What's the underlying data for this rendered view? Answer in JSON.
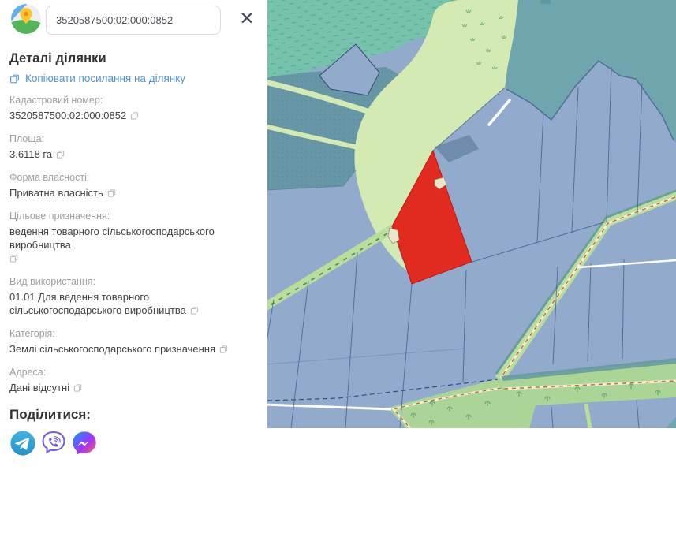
{
  "theme": {
    "panel_bg": "#ffffff",
    "heading": "#303234",
    "label_gray": "#9b9fa4",
    "value_dark": "#3f4347",
    "link_blue": "#4e92d9",
    "icon_gray": "#b7bcc2",
    "close_dark": "#3e4a5c",
    "input_border": "#d8dade",
    "input_text": "#4a4f55",
    "map_parcel_blue": "#92abcd",
    "map_parcel_border": "#3e5d88",
    "map_forest_teal": "#76c2ad",
    "map_deep_teal": "#6fa5ad",
    "map_teal_parcel": "#6796a6",
    "map_field_green": "#d3eab2",
    "map_strip_green": "#b9dd9b",
    "map_band_green": "#abd596",
    "map_shadow_teal": "#64989f",
    "map_path_brown": "#b5703d",
    "map_path_cream": "#f1ecd3",
    "map_red": "#e12a20",
    "map_beige": "#eae6cb"
  },
  "search": {
    "value": "3520587500:02:000:0852"
  },
  "panel": {
    "title": "Деталі ділянки",
    "copy_link_label": "Копіювати посилання на ділянку",
    "close_glyph": "✕"
  },
  "fields": [
    {
      "label": "Кадастровий номер:",
      "value": "3520587500:02:000:0852"
    },
    {
      "label": "Площа:",
      "value": "3.6118 га"
    },
    {
      "label": "Форма власності:",
      "value": "Приватна власність"
    },
    {
      "label": "Цільове призначення:",
      "value": "ведення товарного сільськогосподарського виробництва"
    },
    {
      "label": "Вид використання:",
      "value": "01.01 Для ведення товарного сільськогосподарського виробництва"
    },
    {
      "label": "Категорія:",
      "value": "Землі сільськогосподарського призначення"
    },
    {
      "label": "Адреса:",
      "value": "Дані відсутні"
    }
  ],
  "share": {
    "title": "Поділитися:",
    "icons": [
      {
        "name": "telegram",
        "color": "#34aadf"
      },
      {
        "name": "viber",
        "color": "#7059e8"
      },
      {
        "name": "messenger",
        "color": "#a033fa"
      }
    ]
  },
  "map": {
    "selected_parcel_color": "#e12a20",
    "features": [
      "forest",
      "meadow",
      "field",
      "cadastral-parcels",
      "tree-line-strips",
      "dirt-paths",
      "roads",
      "selected-parcel",
      "buildings"
    ]
  }
}
